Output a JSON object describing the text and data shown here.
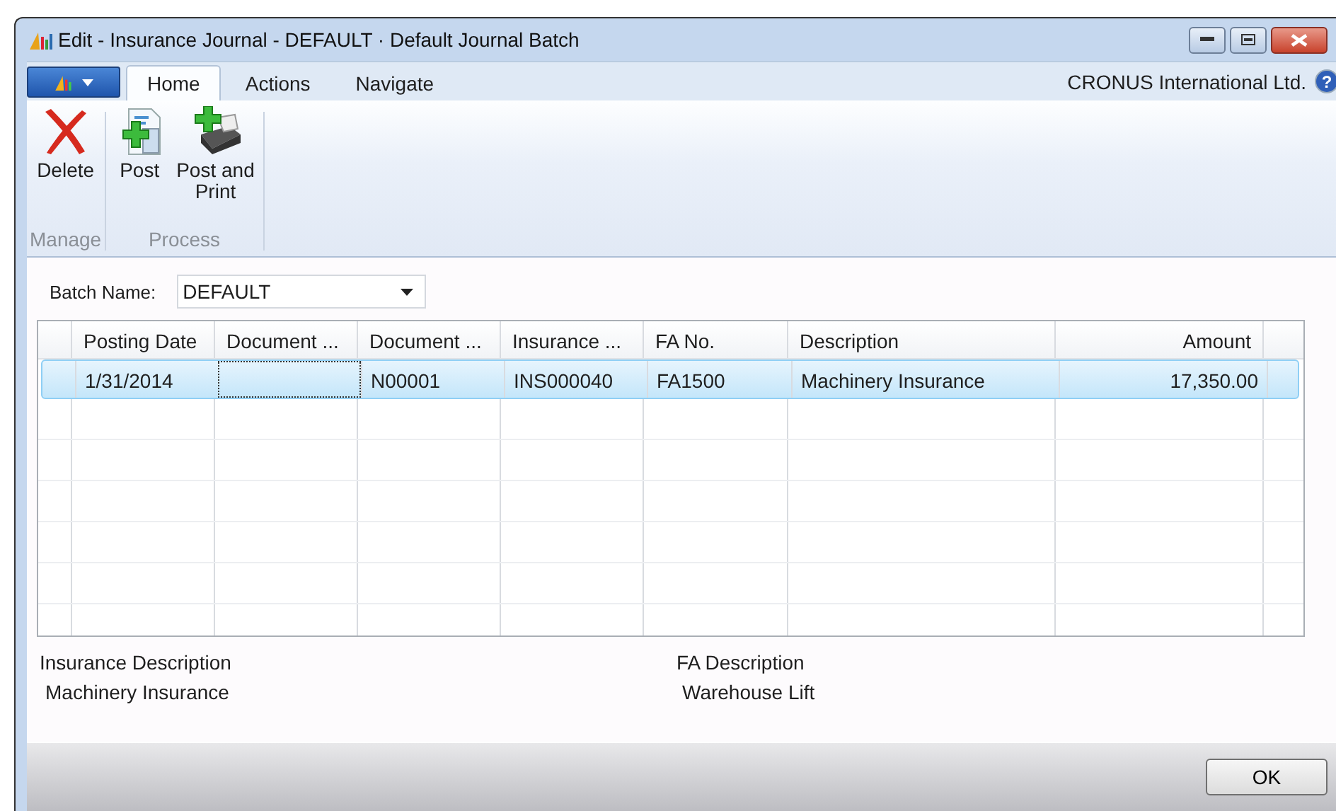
{
  "window": {
    "title": "Edit - Insurance Journal - DEFAULT · Default Journal Batch"
  },
  "tabs": [
    {
      "label": "Home",
      "selected": true
    },
    {
      "label": "Actions",
      "selected": false
    },
    {
      "label": "Navigate",
      "selected": false
    }
  ],
  "company": "CRONUS International Ltd.",
  "help": "?",
  "ribbon_groups": [
    {
      "label": "Manage",
      "actions": [
        {
          "label": "Delete",
          "kind": "delete"
        }
      ]
    },
    {
      "label": "Process",
      "actions": [
        {
          "label": "Post",
          "kind": "post"
        },
        {
          "label": "Post and\nPrint",
          "kind": "print"
        }
      ]
    }
  ],
  "batch_name": {
    "label": "Batch Name:",
    "value": "DEFAULT"
  },
  "table": {
    "columns": [
      "Posting Date",
      "Document ...",
      "Document ...",
      "Insurance ...",
      "FA No.",
      "Description",
      "Amount"
    ],
    "rows": [
      {
        "selected": true,
        "cells": [
          {
            "text": "1/31/2014",
            "focused": false
          },
          {
            "text": "",
            "focused": true
          },
          {
            "text": "N00001",
            "focused": false
          },
          {
            "text": "INS000040",
            "focused": false
          },
          {
            "text": "FA1500",
            "focused": false
          },
          {
            "text": "Machinery Insurance",
            "focused": false
          },
          {
            "text": "17,350.00",
            "focused": false
          }
        ]
      }
    ]
  },
  "details": [
    {
      "label": "Insurance Description",
      "value": "Machinery Insurance"
    },
    {
      "label": "FA Description",
      "value": "Warehouse Lift"
    }
  ],
  "buttons": [
    "OK"
  ]
}
